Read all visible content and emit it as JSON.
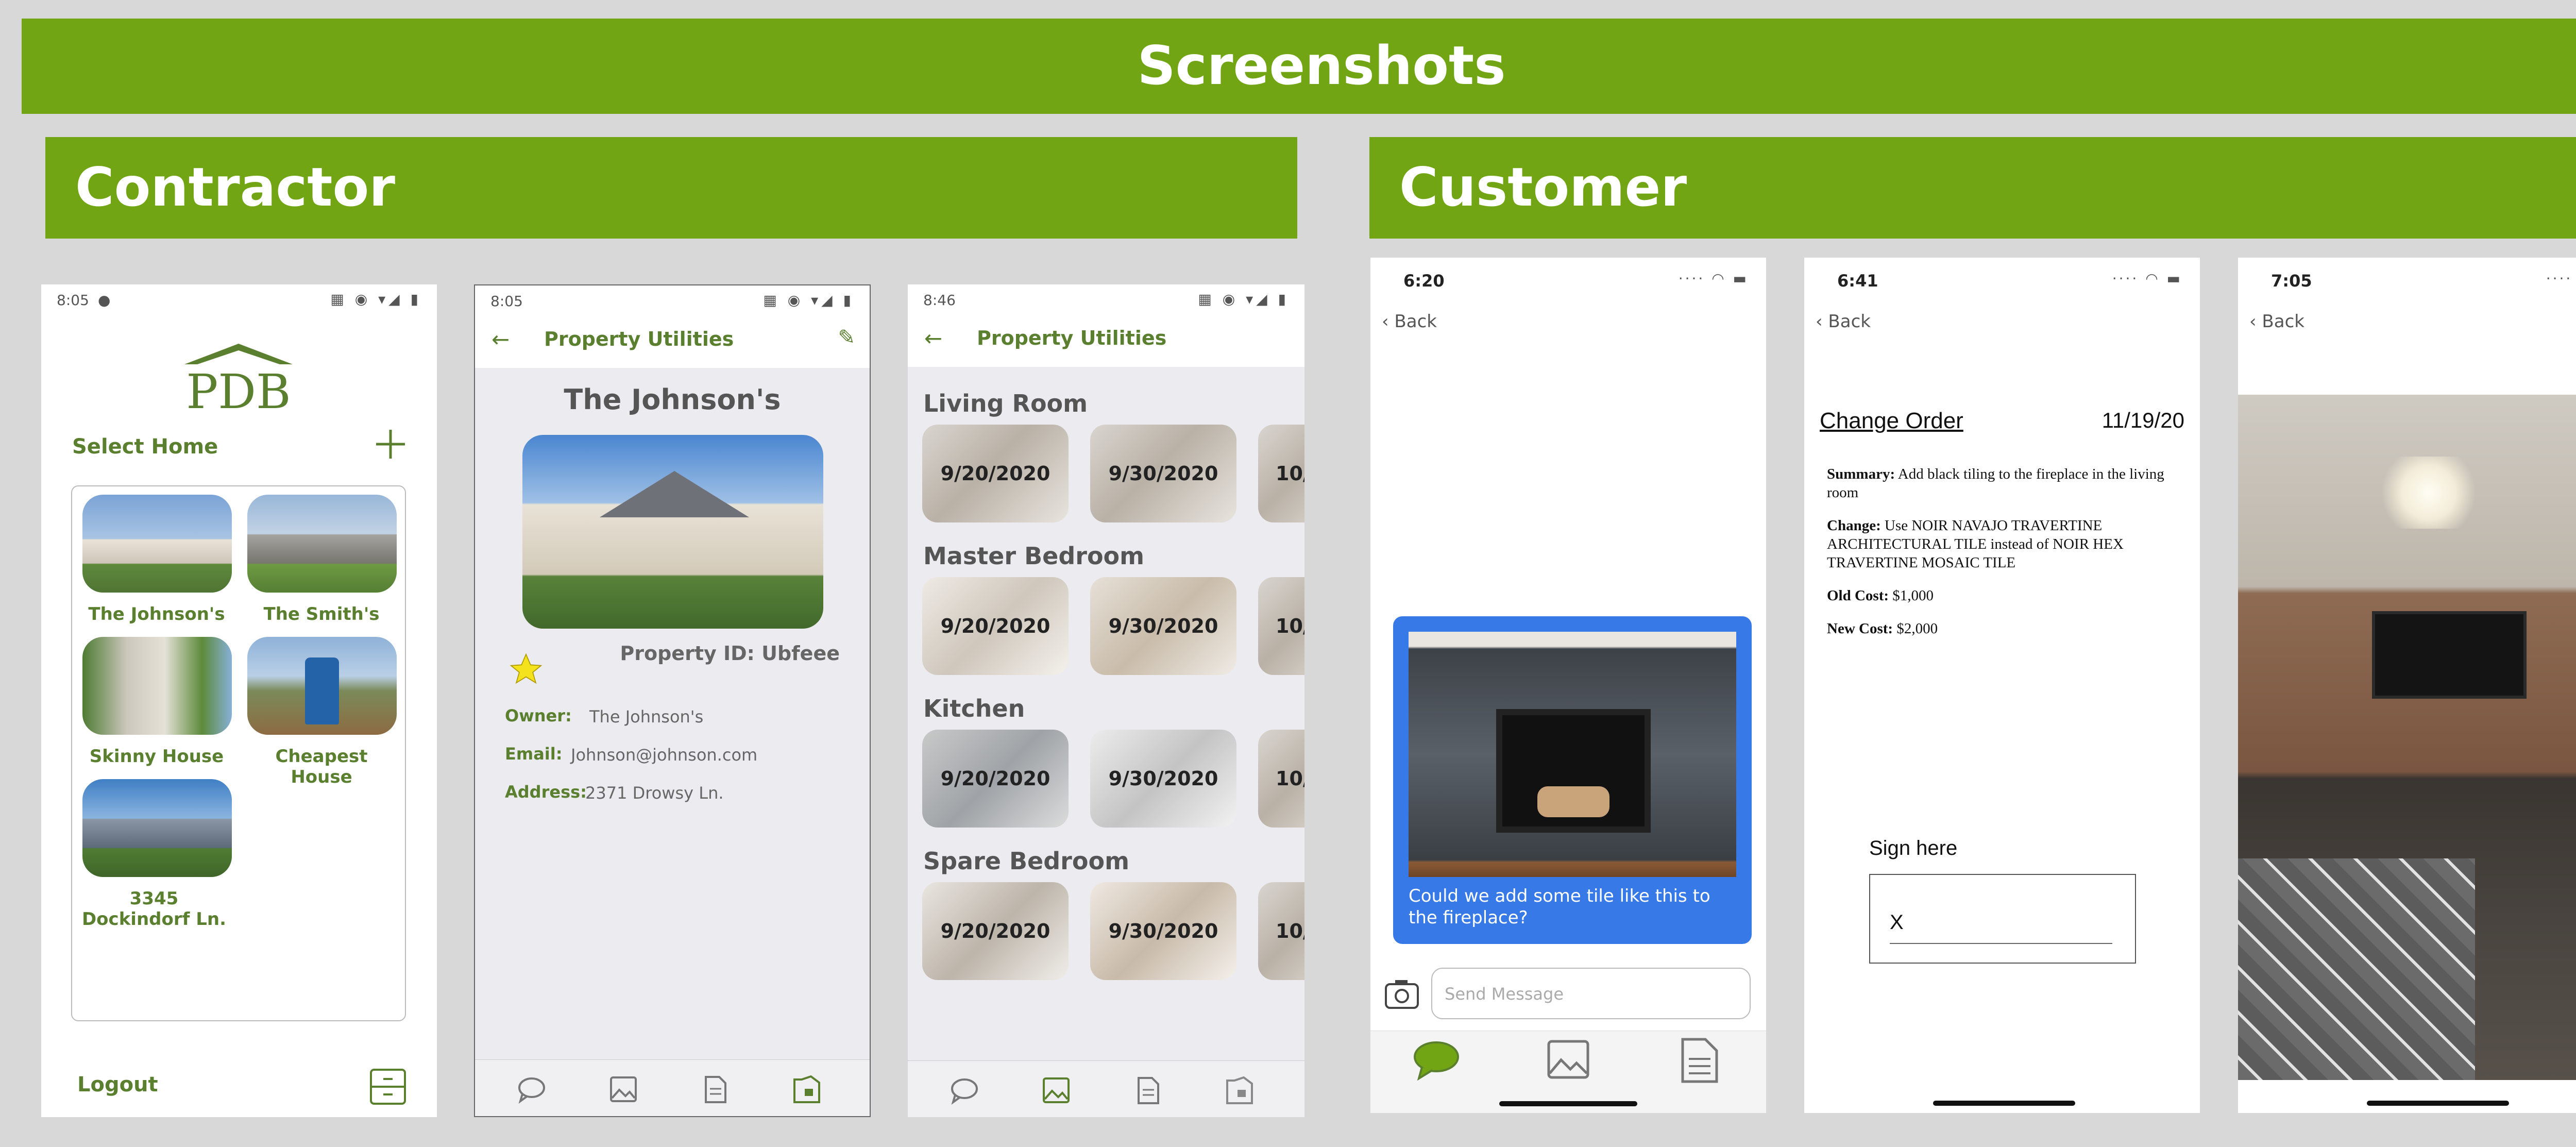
{
  "title": "Screenshots",
  "contractor": {
    "heading": "Contractor",
    "home": {
      "time": "8:05",
      "select_home": "Select Home",
      "houses": [
        {
          "name": "The Johnson's"
        },
        {
          "name": "The Smith's"
        },
        {
          "name": "Skinny House"
        },
        {
          "name": "Cheapest House"
        },
        {
          "name": "3345 Dockindorf Ln."
        }
      ],
      "logout": "Logout"
    },
    "property": {
      "time": "8:05",
      "header": "Property Utilities",
      "name": "The Johnson's",
      "property_id": "Property ID: Ubfeee",
      "owner_label": "Owner:",
      "owner": "The Johnson's",
      "email_label": "Email:",
      "email": "Johnson@johnson.com",
      "address_label": "Address:",
      "address": "2371 Drowsy Ln."
    },
    "gallery": {
      "time": "8:46",
      "header": "Property Utilities",
      "rooms": [
        {
          "name": "Living Room",
          "dates": [
            "9/20/2020",
            "9/30/2020",
            "10/"
          ]
        },
        {
          "name": "Master Bedroom",
          "dates": [
            "9/20/2020",
            "9/30/2020",
            "10/"
          ]
        },
        {
          "name": "Kitchen",
          "dates": [
            "9/20/2020",
            "9/30/2020",
            "10/"
          ]
        },
        {
          "name": "Spare Bedroom",
          "dates": [
            "9/20/2020",
            "9/30/2020",
            "10/"
          ]
        }
      ]
    }
  },
  "customer": {
    "heading": "Customer",
    "chat": {
      "time": "6:20",
      "back": "Back",
      "message": "Could we add some tile like this to the fireplace?",
      "placeholder": "Send Message"
    },
    "change_order": {
      "time": "6:41",
      "back": "Back",
      "title": "Change Order",
      "date": "11/19/20",
      "summary_label": "Summary:",
      "summary": "Add black tiling to the fireplace in the living room",
      "change_label": "Change:",
      "change": "Use NOIR NAVAJO TRAVERTINE ARCHITECTURAL TILE instead of NOIR HEX TRAVERTINE MOSAIC TILE",
      "old_cost_label": "Old Cost:",
      "old_cost": "$1,000",
      "new_cost_label": "New Cost:",
      "new_cost": "$2,000",
      "sign_here": "Sign here",
      "sign_x": "X"
    },
    "photo": {
      "time": "7:05",
      "back": "Back"
    }
  },
  "colors": {
    "brand_green": "#72a514",
    "text_green": "#5a7f2e",
    "chat_blue": "#3779e6"
  }
}
